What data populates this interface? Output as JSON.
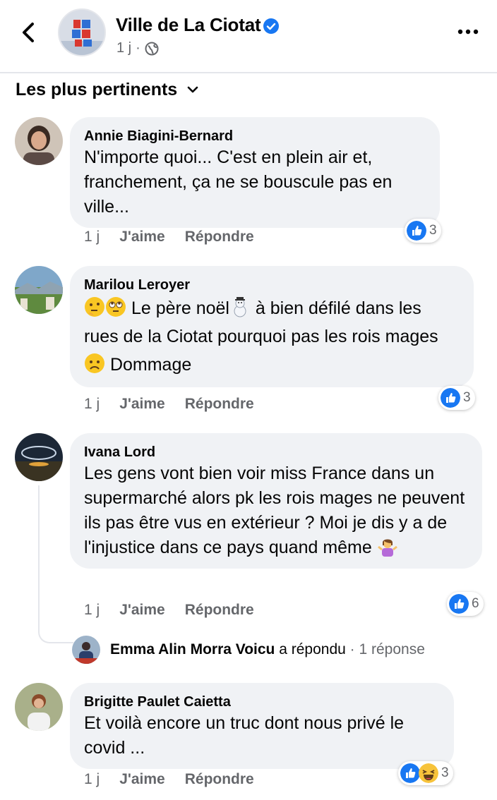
{
  "header": {
    "page_name": "Ville de La Ciotat",
    "time": "1 j",
    "dot": "·"
  },
  "sort": {
    "label": "Les plus pertinents"
  },
  "comments": [
    {
      "author": "Annie Biagini-Bernard",
      "text": "N'importe quoi... C'est en plein air et, franchement, ça ne se bouscule pas en ville...",
      "time": "1 j",
      "like_label": "J'aime",
      "reply_label": "Répondre",
      "reactions": "3"
    },
    {
      "author": "Marilou Leroyer",
      "text_a": "Le père noël",
      "text_b": "à bien défilé dans les rues de la Ciotat pourquoi pas les rois mages",
      "text_c": "Dommage",
      "time": "1 j",
      "like_label": "J'aime",
      "reply_label": "Répondre",
      "reactions": "3"
    },
    {
      "author": "Ivana Lord",
      "text": "Les gens vont bien voir miss France dans un supermarché alors pk les rois mages ne peuvent ils pas être vus en extérieur ? Moi je dis y a de l'injustice dans ce pays quand même",
      "time": "1 j",
      "like_label": "J'aime",
      "reply_label": "Répondre",
      "reactions": "6",
      "reply": {
        "name": "Emma Alin Morra Voicu",
        "verb": "a répondu",
        "count": "· 1 réponse"
      }
    },
    {
      "author": "Brigitte Paulet Caietta",
      "text": "Et voilà encore un truc dont nous privé le covid ...",
      "time": "1 j",
      "like_label": "J'aime",
      "reply_label": "Répondre",
      "reactions": "3"
    }
  ],
  "colors": {
    "accent": "#1877f2",
    "bubble": "#f0f2f5",
    "secondary_text": "#65676b"
  },
  "icons": [
    "back-arrow-icon",
    "verified-badge-icon",
    "globe-icon",
    "more-options-icon",
    "chevron-down-icon",
    "like-reaction-icon",
    "haha-reaction-icon"
  ]
}
